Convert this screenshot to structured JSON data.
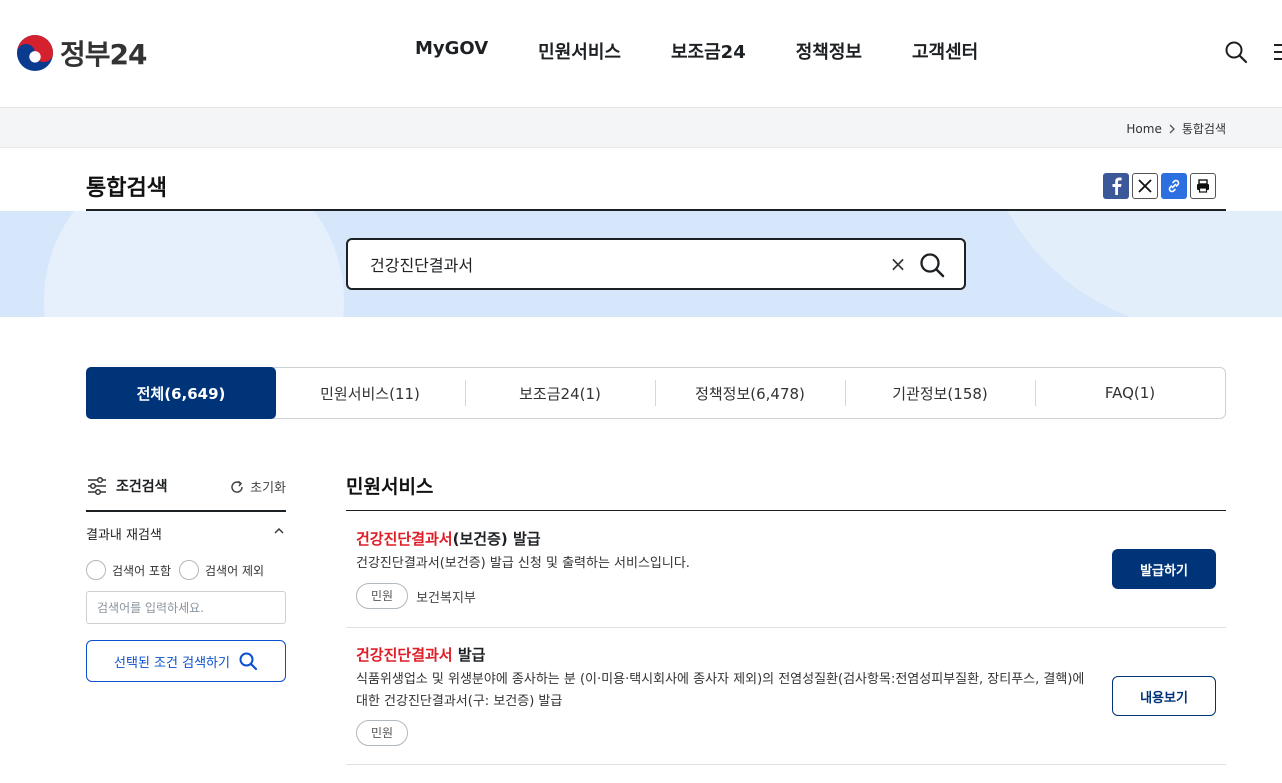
{
  "header": {
    "logo_text": "정부24",
    "nav": [
      "MyGOV",
      "민원서비스",
      "보조금24",
      "정책정보",
      "고객센터"
    ]
  },
  "breadcrumb": {
    "home": "Home",
    "current": "통합검색"
  },
  "page_title": "통합검색",
  "search": {
    "query": "건강진단결과서",
    "clear_label": "×"
  },
  "tabs": [
    {
      "label": "전체(6,649)",
      "active": true
    },
    {
      "label": "민원서비스(11)"
    },
    {
      "label": "보조금24(1)"
    },
    {
      "label": "정책정보(6,478)"
    },
    {
      "label": "기관정보(158)"
    },
    {
      "label": "FAQ(1)"
    }
  ],
  "filter": {
    "title": "조건검색",
    "reset_label": "초기화",
    "refine_label": "결과내 재검색",
    "include_label": "검색어 포함",
    "exclude_label": "검색어 제외",
    "input_placeholder": "검색어를 입력하세요.",
    "submit_label": "선택된 조건 검색하기"
  },
  "results": {
    "section_title": "민원서비스",
    "items": [
      {
        "title_highlight": "건강진단결과서",
        "title_rest": "(보건증) 발급",
        "description": "건강진단결과서(보건증) 발급 신청 및 출력하는 서비스입니다.",
        "badge": "민원",
        "agency": "보건복지부",
        "action": "발급하기"
      },
      {
        "title_highlight": "건강진단결과서",
        "title_rest": " 발급",
        "description": "식품위생업소 및 위생분야에 종사하는 분 (이·미용·택시회사에 종사자 제외)의 전염성질환(검사항목:전염성피부질환, 장티푸스, 결핵)에 대한 건강진단결과서(구: 보건증) 발급",
        "badge": "민원",
        "agency": "",
        "action": "내용보기"
      }
    ]
  },
  "colors": {
    "primary": "#003478",
    "highlight": "#de1d26",
    "link_blue": "#0b50d0",
    "band": "#d6e7fb"
  },
  "icons": [
    "taegeuk-logo-icon",
    "search-icon",
    "menu-icon",
    "chevron-right-icon",
    "facebook-icon",
    "x-icon",
    "link-icon",
    "print-icon",
    "clear-icon",
    "filter-icon",
    "refresh-icon",
    "chevron-up-icon"
  ]
}
